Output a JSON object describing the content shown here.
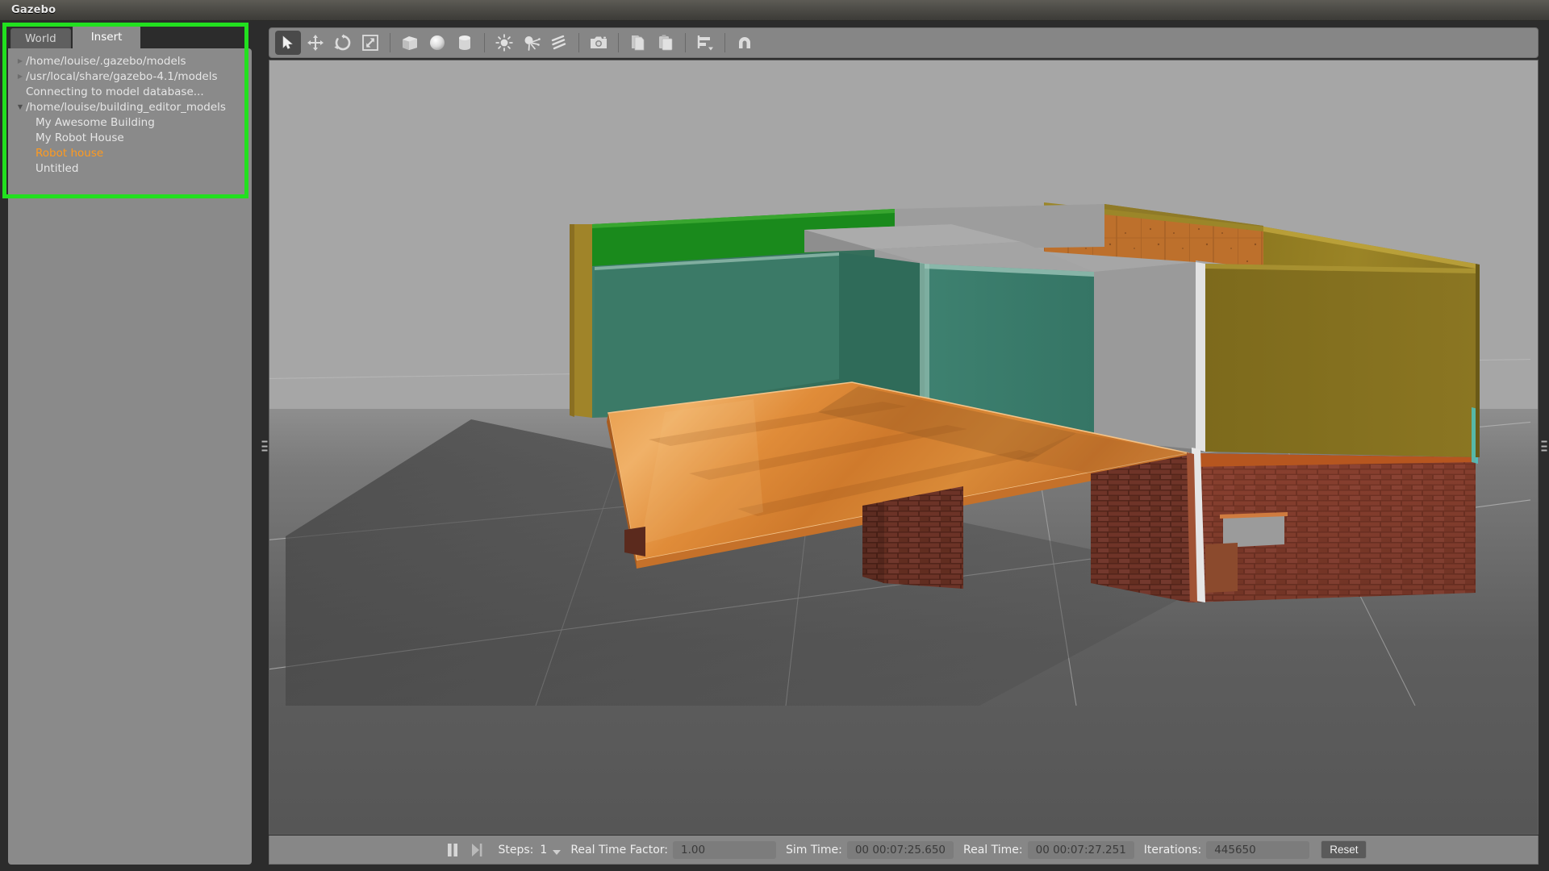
{
  "window": {
    "title": "Gazebo"
  },
  "highlight": {
    "color": "#22e01f"
  },
  "left_panel": {
    "tabs": [
      {
        "label": "World",
        "active": false
      },
      {
        "label": "Insert",
        "active": true
      }
    ],
    "tree": [
      {
        "label": "/home/louise/.gazebo/models",
        "arrow": "collapsed",
        "depth": 0,
        "selected": false
      },
      {
        "label": "/usr/local/share/gazebo-4.1/models",
        "arrow": "collapsed",
        "depth": 0,
        "selected": false
      },
      {
        "label": "Connecting to model database...",
        "arrow": "none",
        "depth": 0,
        "selected": false
      },
      {
        "label": "/home/louise/building_editor_models",
        "arrow": "expanded",
        "depth": 0,
        "selected": false
      },
      {
        "label": "My Awesome Building",
        "arrow": "none",
        "depth": 1,
        "selected": false
      },
      {
        "label": "My Robot House",
        "arrow": "none",
        "depth": 1,
        "selected": false
      },
      {
        "label": "Robot house",
        "arrow": "none",
        "depth": 1,
        "selected": true
      },
      {
        "label": "Untitled",
        "arrow": "none",
        "depth": 1,
        "selected": false
      }
    ],
    "selected_color": "#ff9a1e"
  },
  "toolbar": {
    "items": [
      {
        "name": "select-mode-icon",
        "active": true
      },
      {
        "name": "translate-mode-icon",
        "active": false
      },
      {
        "name": "rotate-mode-icon",
        "active": false
      },
      {
        "name": "scale-mode-icon",
        "active": false
      },
      {
        "name": "insert-box-icon",
        "active": false
      },
      {
        "name": "insert-sphere-icon",
        "active": false
      },
      {
        "name": "insert-cylinder-icon",
        "active": false
      },
      {
        "name": "point-light-icon",
        "active": false
      },
      {
        "name": "spot-light-icon",
        "active": false
      },
      {
        "name": "directional-light-icon",
        "active": false
      },
      {
        "name": "screenshot-icon",
        "active": false
      },
      {
        "name": "copy-icon",
        "active": false
      },
      {
        "name": "paste-icon",
        "active": false
      },
      {
        "name": "align-icon",
        "active": false
      },
      {
        "name": "snap-magnet-icon",
        "active": false
      }
    ]
  },
  "viewport": {
    "scene_name": "robot-house-building-model",
    "sky_color": "#a6a6a6",
    "ground_color": "#5e5e5e",
    "materials": {
      "wall_green": "#3c7a66",
      "wall_green_top": "#168a1a",
      "wall_olive": "#8a7420",
      "wall_grey": "#9c9c9c",
      "floor_wood": "#d2853a",
      "brick": "#7a3828",
      "ceiling_cork": "#b46a2c"
    }
  },
  "status_bar": {
    "pause_icon": "pause-icon",
    "step_icon": "step-forward-icon",
    "steps_label": "Steps:",
    "steps_value": "1",
    "real_time_factor_label": "Real Time Factor:",
    "real_time_factor_value": "1.00",
    "sim_time_label": "Sim Time:",
    "sim_time_value": "00 00:07:25.650",
    "real_time_label": "Real Time:",
    "real_time_value": "00 00:07:27.251",
    "iterations_label": "Iterations:",
    "iterations_value": "445650",
    "reset_label": "Reset"
  }
}
